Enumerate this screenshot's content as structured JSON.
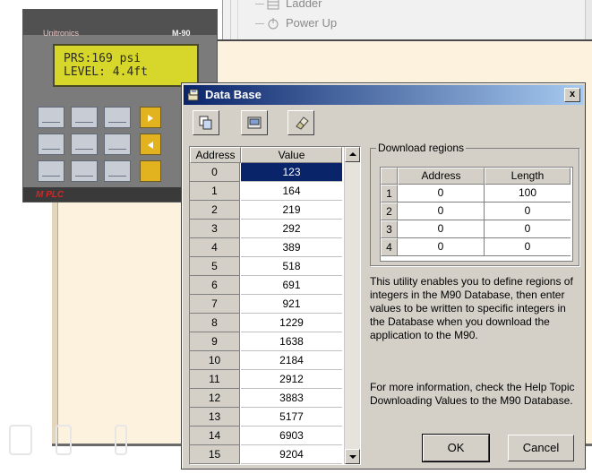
{
  "project_tree": {
    "items": [
      {
        "label": "Ladder",
        "icon": "ladder-icon"
      },
      {
        "label": "Power Up",
        "icon": "power-up-icon"
      }
    ]
  },
  "plc": {
    "brand": "Unitronics",
    "model": "M-90",
    "lcd_line1": "PRS:169 psi",
    "lcd_line2": "LEVEL: 4.4ft",
    "footer": "M PLC",
    "colors": {
      "lcd": "#d7d62a",
      "body": "#7b7b7b",
      "accent": "#c40b0b"
    }
  },
  "dialog": {
    "title": "Data Base",
    "close_label": "x",
    "toolbar": [
      {
        "name": "copy-icon"
      },
      {
        "name": "import-icon"
      },
      {
        "name": "eraser-icon"
      }
    ],
    "table": {
      "columns": [
        "Address",
        "Value"
      ],
      "selected_row": 0,
      "rows": [
        {
          "address": "0",
          "value": "123"
        },
        {
          "address": "1",
          "value": "164"
        },
        {
          "address": "2",
          "value": "219"
        },
        {
          "address": "3",
          "value": "292"
        },
        {
          "address": "4",
          "value": "389"
        },
        {
          "address": "5",
          "value": "518"
        },
        {
          "address": "6",
          "value": "691"
        },
        {
          "address": "7",
          "value": "921"
        },
        {
          "address": "8",
          "value": "1229"
        },
        {
          "address": "9",
          "value": "1638"
        },
        {
          "address": "10",
          "value": "2184"
        },
        {
          "address": "11",
          "value": "2912"
        },
        {
          "address": "12",
          "value": "3883"
        },
        {
          "address": "13",
          "value": "5177"
        },
        {
          "address": "14",
          "value": "6903"
        },
        {
          "address": "15",
          "value": "9204"
        }
      ]
    },
    "regions": {
      "title": "Download regions",
      "columns": [
        "Address",
        "Length"
      ],
      "rows": [
        {
          "n": "1",
          "address": "0",
          "length": "100"
        },
        {
          "n": "2",
          "address": "0",
          "length": "0"
        },
        {
          "n": "3",
          "address": "0",
          "length": "0"
        },
        {
          "n": "4",
          "address": "0",
          "length": "0"
        }
      ]
    },
    "info_text": "This utility enables you to define regions of integers in the M90 Database, then enter values to be written to specific integers in the Database when you download the application to the M90.",
    "help_text": "For more information, check the Help Topic Downloading Values to the M90 Database.",
    "ok_label": "OK",
    "cancel_label": "Cancel"
  }
}
